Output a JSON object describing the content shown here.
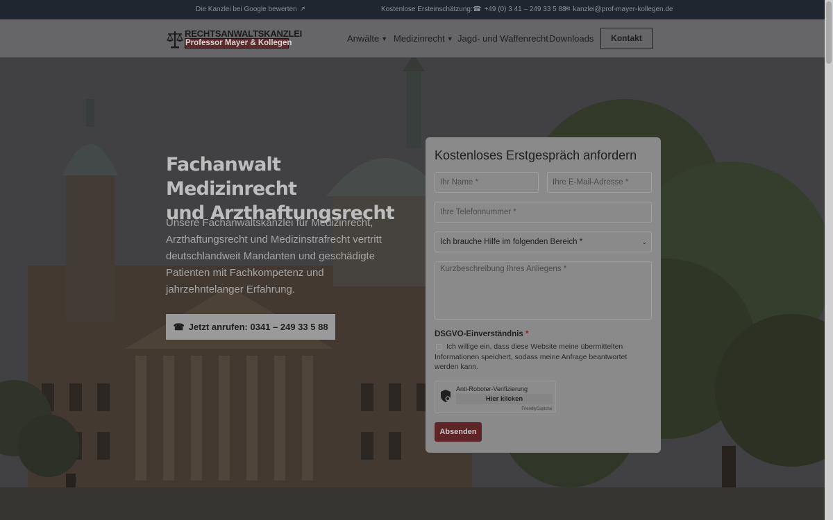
{
  "topbar": {
    "google_review": "Die Kanzlei bei Google bewerten",
    "free_assessment_label": "Kostenlose Ersteinschätzung:",
    "phone": "+49 (0) 3 41 – 249 33 5 88",
    "email": "kanzlei@prof-mayer-kollegen.de"
  },
  "header": {
    "logo_top": "RECHTSANWALTSKANZLEI",
    "logo_bottom": "Professor Mayer & Kollegen",
    "nav": [
      {
        "label": "Anwälte",
        "has_dropdown": true
      },
      {
        "label": "Medizinrecht",
        "has_dropdown": true
      },
      {
        "label": "Jagd- und Waffenrecht",
        "has_dropdown": false
      },
      {
        "label": "Downloads",
        "has_dropdown": false
      }
    ],
    "contact_button": "Kontakt"
  },
  "hero": {
    "title_line1": "Fachanwalt Medizinrecht",
    "title_line2": "und Arzthaftungsrecht",
    "text": "Unsere Fachanwaltskanzlei für Medizinrecht, Arzthaftungsrecht und Medizinstrafrecht vertritt deutschlandweit Mandanten und geschädigte Patienten mit Fachkompetenz und jahrzehntelanger Erfahrung.",
    "call_button": "Jetzt anrufen: 0341 – 249 33 5 88"
  },
  "form": {
    "title": "Kostenloses Erstgespräch anfordern",
    "name_placeholder": "Ihr Name *",
    "email_placeholder": "Ihre E-Mail-Adresse *",
    "phone_placeholder": "Ihre Telefonnummer *",
    "area_select_value": "Ich brauche Hilfe im folgenden Bereich *",
    "description_placeholder": "Kurzbeschreibung Ihres Anliegens *",
    "dsgvo_label": "DSGVO-Einverständnis",
    "dsgvo_required_mark": "*",
    "consent_text": "Ich willige ein, dass diese Website meine übermittelten Informationen speichert, sodass meine Anfrage beantwortet werden kann.",
    "captcha_title": "Anti-Roboter-Verifizierung",
    "captcha_button": "Hier klicken",
    "captcha_brand": "FriendlyCaptcha",
    "submit": "Absenden"
  },
  "colors": {
    "topbar_bg": "#1f2630",
    "header_bg": "#666668",
    "submit_bg": "#5f2426",
    "logo_banner_bg": "#5c2a2c"
  }
}
